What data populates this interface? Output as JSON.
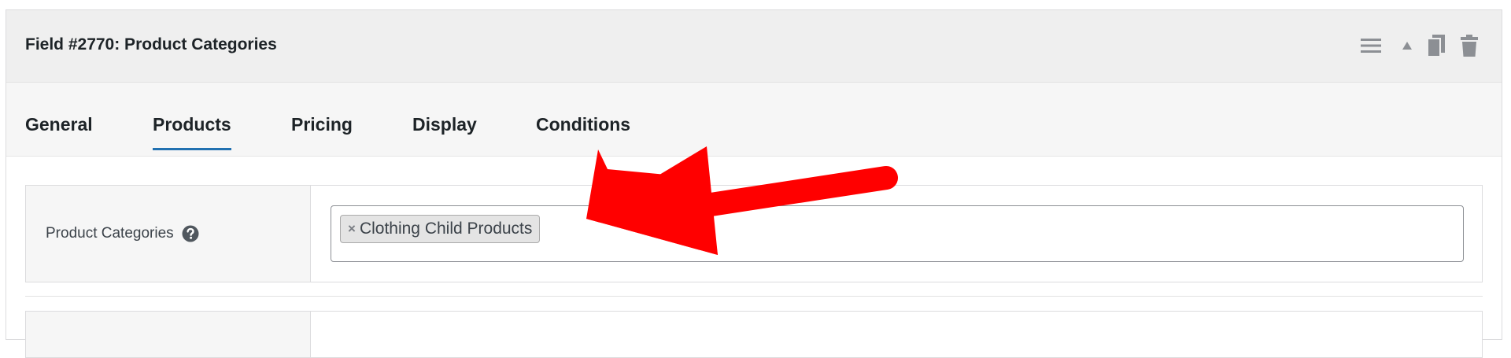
{
  "field": {
    "title": "Field #2770: Product Categories"
  },
  "header_actions": [
    {
      "icon": "menu-icon"
    },
    {
      "icon": "collapse-arrow-icon"
    },
    {
      "icon": "duplicate-icon"
    },
    {
      "icon": "trash-icon"
    }
  ],
  "tabs": [
    {
      "label": "General",
      "active": false
    },
    {
      "label": "Products",
      "active": true
    },
    {
      "label": "Pricing",
      "active": false
    },
    {
      "label": "Display",
      "active": false
    },
    {
      "label": "Conditions",
      "active": false
    }
  ],
  "product_categories": {
    "label": "Product Categories",
    "help_icon": "question-circle-icon",
    "selected": [
      {
        "remove_symbol": "×",
        "label": "Clothing Child Products"
      }
    ]
  },
  "colors": {
    "accent": "#2271b1",
    "annotation_arrow": "#ff0000",
    "header_bg": "#efefef",
    "tabs_bg": "#f6f6f6"
  }
}
